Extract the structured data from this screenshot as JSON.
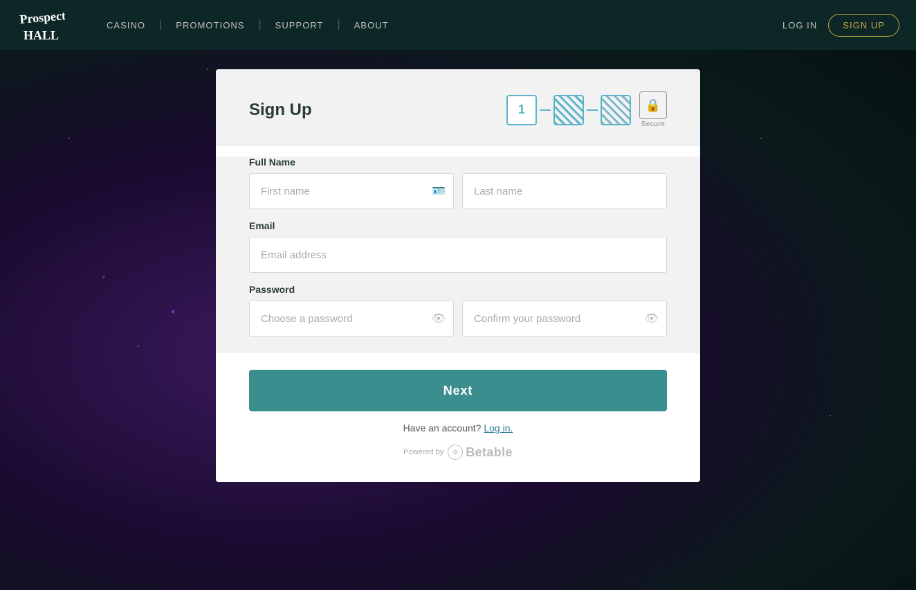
{
  "header": {
    "nav": {
      "items": [
        {
          "label": "CASINO",
          "id": "casino"
        },
        {
          "label": "PROMOTIONS",
          "id": "promotions"
        },
        {
          "label": "SUPPORT",
          "id": "support"
        },
        {
          "label": "ABOUT",
          "id": "about"
        }
      ]
    },
    "login_label": "LOG IN",
    "signup_label": "SIGN UP"
  },
  "modal": {
    "title": "Sign Up",
    "steps": {
      "step1_label": "1",
      "step2_label": "",
      "step3_label": "",
      "secure_label": "Secure"
    },
    "form": {
      "full_name_label": "Full Name",
      "first_name_placeholder": "First name",
      "last_name_placeholder": "Last name",
      "email_label": "Email",
      "email_placeholder": "Email address",
      "password_label": "Password",
      "choose_password_placeholder": "Choose a password",
      "confirm_password_placeholder": "Confirm your password"
    },
    "next_button": "Next",
    "login_text": "Have an account?",
    "login_link": "Log in.",
    "powered_by_text": "Powered by",
    "betable_label": "Betable"
  }
}
